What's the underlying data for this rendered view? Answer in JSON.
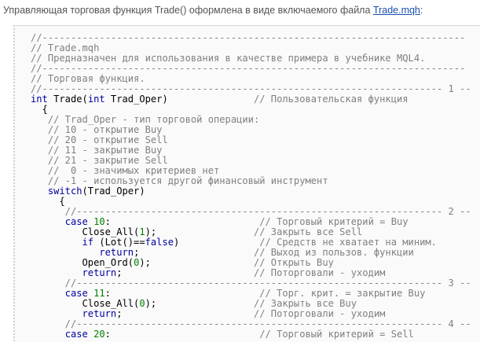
{
  "intro": {
    "text": "Управляющая торговая функция Trade() оформлена в виде включаемого файла ",
    "link": "Trade.mqh",
    "end": ":"
  },
  "code": {
    "lines": [
      [
        [
          "c",
          "//--------------------------------------------------------------------------"
        ]
      ],
      [
        [
          "c",
          "// Trade.mqh"
        ]
      ],
      [
        [
          "c",
          "// Предназначен для использования в качестве примера в учебнике MQL4."
        ]
      ],
      [
        [
          "c",
          "//--------------------------------------------------------------------------"
        ]
      ],
      [
        [
          "c",
          "// Торговая функция."
        ]
      ],
      [
        [
          "c",
          "//---------------------------------------------------------------------- 1 --"
        ]
      ],
      [
        [
          "k",
          "int"
        ],
        [
          "t",
          " Trade("
        ],
        [
          "k",
          "int"
        ],
        [
          "t",
          " Trad_Oper)               "
        ],
        [
          "c",
          "// Пользовательская функция"
        ]
      ],
      [
        [
          "t",
          "  {"
        ]
      ],
      [
        [
          "c",
          "   // Trad_Oper - тип торговой операции:"
        ]
      ],
      [
        [
          "c",
          "   // 10 - открытие Buy"
        ]
      ],
      [
        [
          "c",
          "   // 20 - открытие Sell"
        ]
      ],
      [
        [
          "c",
          "   // 11 - закрытие Buy"
        ]
      ],
      [
        [
          "c",
          "   // 21 - закрытие Sell"
        ]
      ],
      [
        [
          "c",
          "   //  0 - значимых критериев нет"
        ]
      ],
      [
        [
          "c",
          "   // -1 - используется другой финансовый инструмент"
        ]
      ],
      [
        [
          "t",
          "   "
        ],
        [
          "k",
          "switch"
        ],
        [
          "t",
          "(Trad_Oper)"
        ]
      ],
      [
        [
          "t",
          "     {"
        ]
      ],
      [
        [
          "c",
          "      //---------------------------------------------------------------- 2 --"
        ]
      ],
      [
        [
          "t",
          "      "
        ],
        [
          "k",
          "case"
        ],
        [
          "t",
          " "
        ],
        [
          "n",
          "10"
        ],
        [
          "t",
          ":                          "
        ],
        [
          "c",
          "// Торговый критерий = Buy"
        ]
      ],
      [
        [
          "t",
          "         Close_All("
        ],
        [
          "n",
          "1"
        ],
        [
          "t",
          ");                 "
        ],
        [
          "c",
          "// Закрыть все Sell"
        ]
      ],
      [
        [
          "t",
          "         "
        ],
        [
          "k",
          "if"
        ],
        [
          "t",
          " (Lot()=="
        ],
        [
          "k",
          "false"
        ],
        [
          "t",
          ")              "
        ],
        [
          "c",
          "// Средств не хватает на миним."
        ]
      ],
      [
        [
          "t",
          "            "
        ],
        [
          "k",
          "return"
        ],
        [
          "t",
          ";                    "
        ],
        [
          "c",
          "// Выход из пользов. функции"
        ]
      ],
      [
        [
          "t",
          "         Open_Ord("
        ],
        [
          "n",
          "0"
        ],
        [
          "t",
          ");                  "
        ],
        [
          "c",
          "// Открыть Buy"
        ]
      ],
      [
        [
          "t",
          "         "
        ],
        [
          "k",
          "return"
        ],
        [
          "t",
          ";                       "
        ],
        [
          "c",
          "// Поторговали - уходим"
        ]
      ],
      [
        [
          "c",
          "      //---------------------------------------------------------------- 3 --"
        ]
      ],
      [
        [
          "t",
          "      "
        ],
        [
          "k",
          "case"
        ],
        [
          "t",
          " "
        ],
        [
          "n",
          "11"
        ],
        [
          "t",
          ":                          "
        ],
        [
          "c",
          "// Торг. крит. = закрытие Buy"
        ]
      ],
      [
        [
          "t",
          "         Close_All("
        ],
        [
          "n",
          "0"
        ],
        [
          "t",
          ");                 "
        ],
        [
          "c",
          "// Закрыть все Buy"
        ]
      ],
      [
        [
          "t",
          "         "
        ],
        [
          "k",
          "return"
        ],
        [
          "t",
          ";                       "
        ],
        [
          "c",
          "// Поторговали - уходим"
        ]
      ],
      [
        [
          "c",
          "      //---------------------------------------------------------------- 4 --"
        ]
      ],
      [
        [
          "t",
          "      "
        ],
        [
          "k",
          "case"
        ],
        [
          "t",
          " "
        ],
        [
          "n",
          "20"
        ],
        [
          "t",
          ":                          "
        ],
        [
          "c",
          "// Торговый критерий = Sell"
        ]
      ]
    ]
  }
}
